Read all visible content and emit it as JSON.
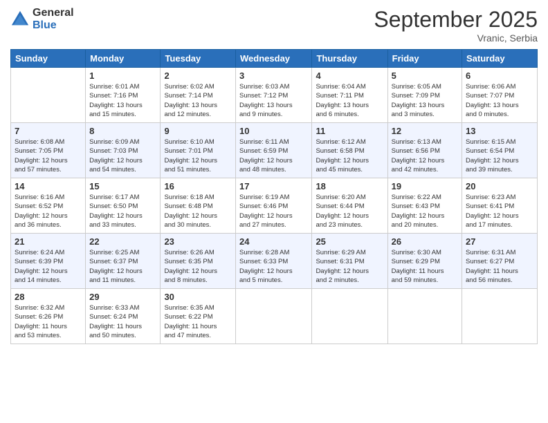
{
  "header": {
    "logo_line1": "General",
    "logo_line2": "Blue",
    "month": "September 2025",
    "location": "Vranic, Serbia"
  },
  "weekdays": [
    "Sunday",
    "Monday",
    "Tuesday",
    "Wednesday",
    "Thursday",
    "Friday",
    "Saturday"
  ],
  "weeks": [
    [
      {
        "day": "",
        "info": ""
      },
      {
        "day": "1",
        "info": "Sunrise: 6:01 AM\nSunset: 7:16 PM\nDaylight: 13 hours\nand 15 minutes."
      },
      {
        "day": "2",
        "info": "Sunrise: 6:02 AM\nSunset: 7:14 PM\nDaylight: 13 hours\nand 12 minutes."
      },
      {
        "day": "3",
        "info": "Sunrise: 6:03 AM\nSunset: 7:12 PM\nDaylight: 13 hours\nand 9 minutes."
      },
      {
        "day": "4",
        "info": "Sunrise: 6:04 AM\nSunset: 7:11 PM\nDaylight: 13 hours\nand 6 minutes."
      },
      {
        "day": "5",
        "info": "Sunrise: 6:05 AM\nSunset: 7:09 PM\nDaylight: 13 hours\nand 3 minutes."
      },
      {
        "day": "6",
        "info": "Sunrise: 6:06 AM\nSunset: 7:07 PM\nDaylight: 13 hours\nand 0 minutes."
      }
    ],
    [
      {
        "day": "7",
        "info": "Sunrise: 6:08 AM\nSunset: 7:05 PM\nDaylight: 12 hours\nand 57 minutes."
      },
      {
        "day": "8",
        "info": "Sunrise: 6:09 AM\nSunset: 7:03 PM\nDaylight: 12 hours\nand 54 minutes."
      },
      {
        "day": "9",
        "info": "Sunrise: 6:10 AM\nSunset: 7:01 PM\nDaylight: 12 hours\nand 51 minutes."
      },
      {
        "day": "10",
        "info": "Sunrise: 6:11 AM\nSunset: 6:59 PM\nDaylight: 12 hours\nand 48 minutes."
      },
      {
        "day": "11",
        "info": "Sunrise: 6:12 AM\nSunset: 6:58 PM\nDaylight: 12 hours\nand 45 minutes."
      },
      {
        "day": "12",
        "info": "Sunrise: 6:13 AM\nSunset: 6:56 PM\nDaylight: 12 hours\nand 42 minutes."
      },
      {
        "day": "13",
        "info": "Sunrise: 6:15 AM\nSunset: 6:54 PM\nDaylight: 12 hours\nand 39 minutes."
      }
    ],
    [
      {
        "day": "14",
        "info": "Sunrise: 6:16 AM\nSunset: 6:52 PM\nDaylight: 12 hours\nand 36 minutes."
      },
      {
        "day": "15",
        "info": "Sunrise: 6:17 AM\nSunset: 6:50 PM\nDaylight: 12 hours\nand 33 minutes."
      },
      {
        "day": "16",
        "info": "Sunrise: 6:18 AM\nSunset: 6:48 PM\nDaylight: 12 hours\nand 30 minutes."
      },
      {
        "day": "17",
        "info": "Sunrise: 6:19 AM\nSunset: 6:46 PM\nDaylight: 12 hours\nand 27 minutes."
      },
      {
        "day": "18",
        "info": "Sunrise: 6:20 AM\nSunset: 6:44 PM\nDaylight: 12 hours\nand 23 minutes."
      },
      {
        "day": "19",
        "info": "Sunrise: 6:22 AM\nSunset: 6:43 PM\nDaylight: 12 hours\nand 20 minutes."
      },
      {
        "day": "20",
        "info": "Sunrise: 6:23 AM\nSunset: 6:41 PM\nDaylight: 12 hours\nand 17 minutes."
      }
    ],
    [
      {
        "day": "21",
        "info": "Sunrise: 6:24 AM\nSunset: 6:39 PM\nDaylight: 12 hours\nand 14 minutes."
      },
      {
        "day": "22",
        "info": "Sunrise: 6:25 AM\nSunset: 6:37 PM\nDaylight: 12 hours\nand 11 minutes."
      },
      {
        "day": "23",
        "info": "Sunrise: 6:26 AM\nSunset: 6:35 PM\nDaylight: 12 hours\nand 8 minutes."
      },
      {
        "day": "24",
        "info": "Sunrise: 6:28 AM\nSunset: 6:33 PM\nDaylight: 12 hours\nand 5 minutes."
      },
      {
        "day": "25",
        "info": "Sunrise: 6:29 AM\nSunset: 6:31 PM\nDaylight: 12 hours\nand 2 minutes."
      },
      {
        "day": "26",
        "info": "Sunrise: 6:30 AM\nSunset: 6:29 PM\nDaylight: 11 hours\nand 59 minutes."
      },
      {
        "day": "27",
        "info": "Sunrise: 6:31 AM\nSunset: 6:27 PM\nDaylight: 11 hours\nand 56 minutes."
      }
    ],
    [
      {
        "day": "28",
        "info": "Sunrise: 6:32 AM\nSunset: 6:26 PM\nDaylight: 11 hours\nand 53 minutes."
      },
      {
        "day": "29",
        "info": "Sunrise: 6:33 AM\nSunset: 6:24 PM\nDaylight: 11 hours\nand 50 minutes."
      },
      {
        "day": "30",
        "info": "Sunrise: 6:35 AM\nSunset: 6:22 PM\nDaylight: 11 hours\nand 47 minutes."
      },
      {
        "day": "",
        "info": ""
      },
      {
        "day": "",
        "info": ""
      },
      {
        "day": "",
        "info": ""
      },
      {
        "day": "",
        "info": ""
      }
    ]
  ]
}
